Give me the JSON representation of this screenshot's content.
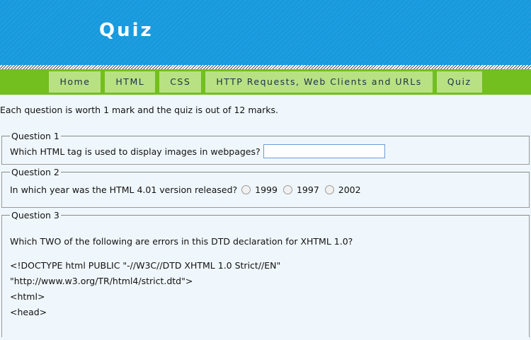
{
  "header": {
    "title": "Quiz"
  },
  "nav": [
    "Home",
    "HTML",
    "CSS",
    "HTTP Requests, Web Clients and URLs",
    "Quiz"
  ],
  "intro": "Each question is worth 1 mark and the quiz is out of 12 marks.",
  "q1": {
    "legend": "Question 1",
    "text": "Which HTML tag is used to display images in webpages?",
    "answer_value": ""
  },
  "q2": {
    "legend": "Question 2",
    "text": "In which year was the HTML 4.01 version released?",
    "options": [
      "1999",
      "1997",
      "2002"
    ]
  },
  "q3": {
    "legend": "Question 3",
    "text": "Which TWO of the following are errors in this DTD declaration for XHTML 1.0?",
    "code": [
      "<!DOCTYPE html PUBLIC \"-//W3C//DTD XHTML 1.0 Strict//EN\"",
      "\"http://www.w3.org/TR/html4/strict.dtd\">",
      "<html>",
      "<head>"
    ]
  }
}
